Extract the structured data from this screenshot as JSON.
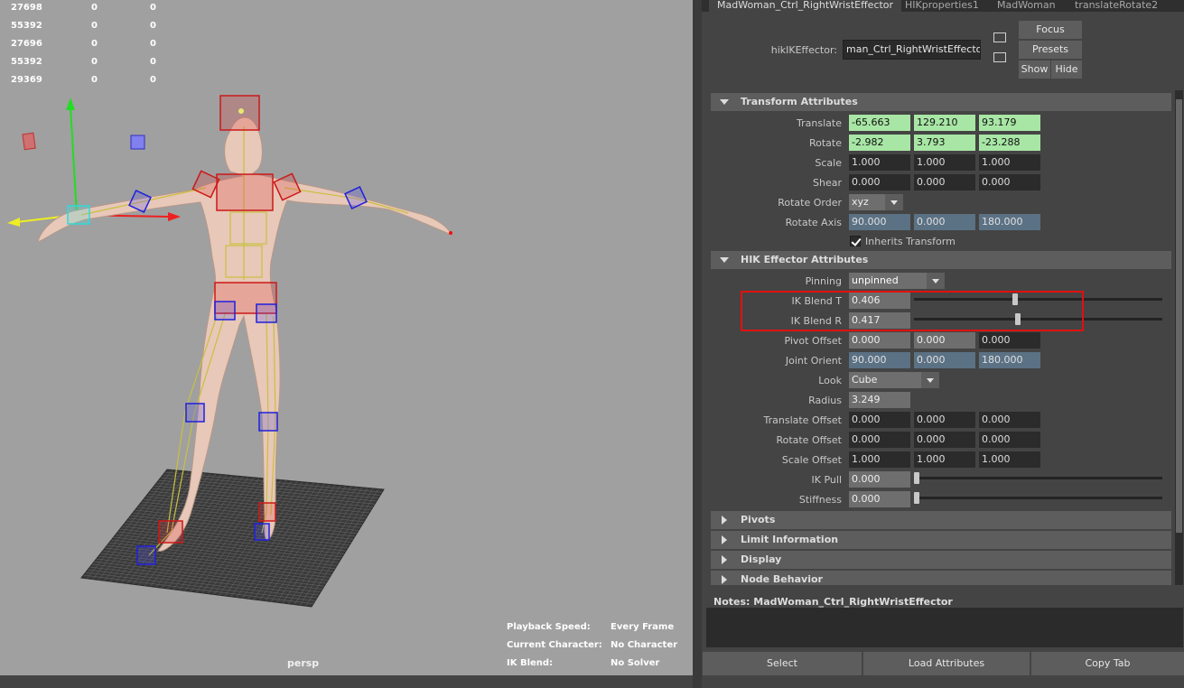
{
  "hud": {
    "rows": [
      {
        "a": "27698",
        "b": "0",
        "c": "0"
      },
      {
        "a": "55392",
        "b": "0",
        "c": "0"
      },
      {
        "a": "27696",
        "b": "0",
        "c": "0"
      },
      {
        "a": "55392",
        "b": "0",
        "c": "0"
      },
      {
        "a": "29369",
        "b": "0",
        "c": "0"
      }
    ]
  },
  "viewport": {
    "camera": "persp",
    "info": [
      {
        "label": "Playback Speed:",
        "value": "Every Frame"
      },
      {
        "label": "Current Character:",
        "value": "No Character"
      },
      {
        "label": "IK Blend:",
        "value": "No Solver"
      }
    ]
  },
  "tabs": [
    "MadWoman_Ctrl_RightWristEffector",
    "HIKproperties1",
    "MadWoman",
    "translateRotate2"
  ],
  "node": {
    "label": "hikIKEffector:",
    "value": "man_Ctrl_RightWristEffector",
    "focus": "Focus",
    "presets": "Presets",
    "show": "Show",
    "hide": "Hide"
  },
  "transform": {
    "title": "Transform Attributes",
    "translate": {
      "label": "Translate",
      "values": [
        "-65.663",
        "129.210",
        "93.179"
      ]
    },
    "rotate": {
      "label": "Rotate",
      "values": [
        "-2.982",
        "3.793",
        "-23.288"
      ]
    },
    "scale": {
      "label": "Scale",
      "values": [
        "1.000",
        "1.000",
        "1.000"
      ]
    },
    "shear": {
      "label": "Shear",
      "values": [
        "0.000",
        "0.000",
        "0.000"
      ]
    },
    "rotate_order": {
      "label": "Rotate Order",
      "value": "xyz"
    },
    "rotate_axis": {
      "label": "Rotate Axis",
      "values": [
        "90.000",
        "0.000",
        "180.000"
      ]
    },
    "inherits": "Inherits Transform"
  },
  "hik": {
    "title": "HIK Effector Attributes",
    "pinning": {
      "label": "Pinning",
      "value": "unpinned"
    },
    "ik_blend_t": {
      "label": "IK Blend T",
      "value": "0.406",
      "level": 0.406
    },
    "ik_blend_r": {
      "label": "IK Blend R",
      "value": "0.417",
      "level": 0.417
    },
    "pivot_offset": {
      "label": "Pivot Offset",
      "values": [
        "0.000",
        "0.000",
        "0.000"
      ]
    },
    "joint_orient": {
      "label": "Joint Orient",
      "values": [
        "90.000",
        "0.000",
        "180.000"
      ]
    },
    "look": {
      "label": "Look",
      "value": "Cube"
    },
    "radius": {
      "label": "Radius",
      "value": "3.249"
    },
    "translate_offset": {
      "label": "Translate Offset",
      "values": [
        "0.000",
        "0.000",
        "0.000"
      ]
    },
    "rotate_offset": {
      "label": "Rotate Offset",
      "values": [
        "0.000",
        "0.000",
        "0.000"
      ]
    },
    "scale_offset": {
      "label": "Scale Offset",
      "values": [
        "1.000",
        "1.000",
        "1.000"
      ]
    },
    "ik_pull": {
      "label": "IK Pull",
      "value": "0.000",
      "level": 0.0
    },
    "stiffness": {
      "label": "Stiffness",
      "value": "0.000",
      "level": 0.0
    }
  },
  "sections": [
    "Pivots",
    "Limit Information",
    "Display",
    "Node Behavior"
  ],
  "notes": {
    "label": "Notes:",
    "value": "MadWoman_Ctrl_RightWristEffector"
  },
  "bottom": {
    "select": "Select",
    "load": "Load Attributes",
    "copy": "Copy Tab"
  },
  "colors": {
    "highlight_box": "#e01010",
    "green_field": "#a8e6a5"
  }
}
